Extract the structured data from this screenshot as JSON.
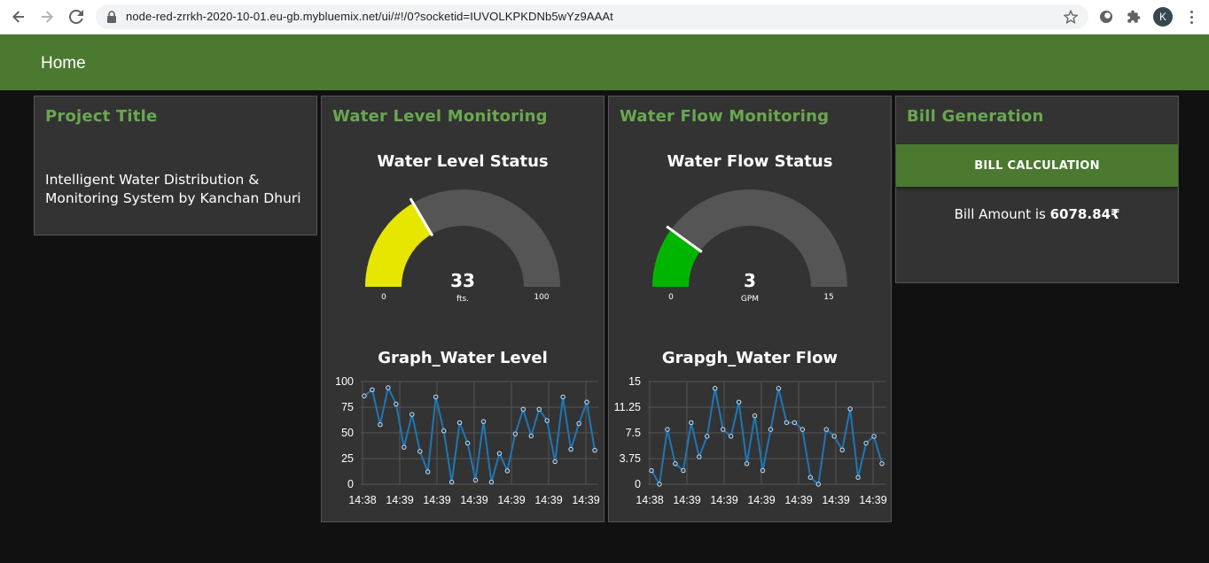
{
  "browser": {
    "url": "node-red-zrrkh-2020-10-01.eu-gb.mybluemix.net/ui/#!/0?socketid=IUVOLKPKDNb5wYz9AAAt",
    "profile_initial": "K"
  },
  "toolbar": {
    "title": "Home"
  },
  "cards": {
    "project": {
      "title": "Project Title",
      "text": "Intelligent Water Distribution & Monitoring System by Kanchan Dhuri"
    },
    "water_level": {
      "title": "Water Level Monitoring",
      "gauge": {
        "label": "Water Level Status",
        "value": 33,
        "value_text": "33",
        "units": "fts.",
        "min": 0,
        "max": 100,
        "min_label": "0",
        "max_label": "100",
        "color": "#e6e600"
      },
      "chart_title": "Graph_Water Level"
    },
    "water_flow": {
      "title": "Water Flow Monitoring",
      "gauge": {
        "label": "Water Flow Status",
        "value": 3,
        "value_text": "3",
        "units": "GPM",
        "min": 0,
        "max": 15,
        "min_label": "0",
        "max_label": "15",
        "color": "#00b500"
      },
      "chart_title": "Grapgh_Water Flow"
    },
    "bill": {
      "title": "Bill Generation",
      "button_label": "BILL CALCULATION",
      "amount_prefix": "Bill Amount is ",
      "amount_value": "6078.84₹"
    }
  },
  "colors": {
    "accent": "#4b7930",
    "title_green": "#6aa84f",
    "line": "#1f77b4",
    "card_bg": "#333333",
    "page_bg": "#111111",
    "gauge_bg": "#555555"
  },
  "chart_data": [
    {
      "type": "line",
      "title": "Graph_Water Level",
      "ylim": [
        0,
        100
      ],
      "yticks": [
        "0",
        "25",
        "50",
        "75",
        "100"
      ],
      "xtick_labels": [
        "14:38",
        "14:39",
        "14:39",
        "14:39",
        "14:39",
        "14:39",
        "14:39"
      ],
      "series": [
        {
          "values": [
            86,
            92,
            58,
            94,
            78,
            36,
            68,
            32,
            12,
            85,
            52,
            2,
            60,
            40,
            4,
            61,
            2,
            30,
            13,
            49,
            73,
            47,
            73,
            62,
            22,
            85,
            34,
            59,
            80,
            33
          ]
        }
      ]
    },
    {
      "type": "line",
      "title": "Grapgh_Water Flow",
      "ylim": [
        0,
        15
      ],
      "yticks": [
        "0",
        "3.75",
        "7.5",
        "11.25",
        "15"
      ],
      "xtick_labels": [
        "14:38",
        "14:39",
        "14:39",
        "14:39",
        "14:39",
        "14:39",
        "14:39"
      ],
      "series": [
        {
          "values": [
            2,
            0,
            8,
            3,
            2,
            9,
            4,
            7,
            14,
            8,
            7,
            12,
            3,
            10,
            2,
            8,
            14,
            9,
            9,
            8,
            1,
            0,
            8,
            7,
            5,
            11,
            1,
            6,
            7,
            3
          ]
        }
      ]
    }
  ]
}
